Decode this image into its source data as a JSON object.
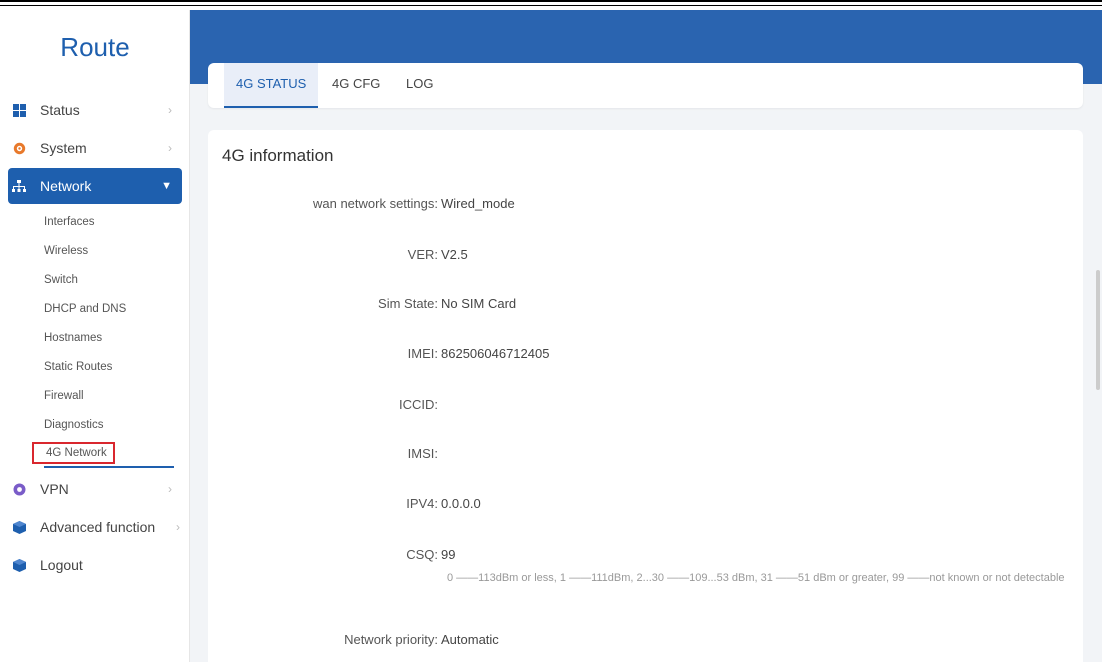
{
  "brand": "Route",
  "menu": {
    "status": "Status",
    "system": "System",
    "network": "Network",
    "vpn": "VPN",
    "advanced": "Advanced function",
    "logout": "Logout"
  },
  "submenu": [
    "Interfaces",
    "Wireless",
    "Switch",
    "DHCP and DNS",
    "Hostnames",
    "Static Routes",
    "Firewall",
    "Diagnostics",
    "4G Network"
  ],
  "tabs": [
    "4G STATUS",
    "4G CFG",
    "LOG"
  ],
  "panel": {
    "title": "4G information",
    "rows": [
      {
        "label": "wan network settings:",
        "value": "Wired_mode"
      },
      {
        "label": "VER:",
        "value": "V2.5"
      },
      {
        "label": "Sim State:",
        "value": "No SIM Card"
      },
      {
        "label": "IMEI:",
        "value": "862506046712405"
      },
      {
        "label": "ICCID:",
        "value": ""
      },
      {
        "label": "IMSI:",
        "value": ""
      },
      {
        "label": "IPV4:",
        "value": "0.0.0.0"
      },
      {
        "label": "CSQ:",
        "value": "99"
      },
      {
        "label": "Network priority:",
        "value": "Automatic"
      }
    ],
    "csq_note": "0 ——113dBm or less, 1 ——111dBm, 2...30 ——109...53 dBm, 31 ——51 dBm or greater, 99 ——not known or not detectable"
  },
  "colors": {
    "accent": "#1e5fae",
    "header": "#2a64b0",
    "highlight_box": "#d9272e"
  }
}
